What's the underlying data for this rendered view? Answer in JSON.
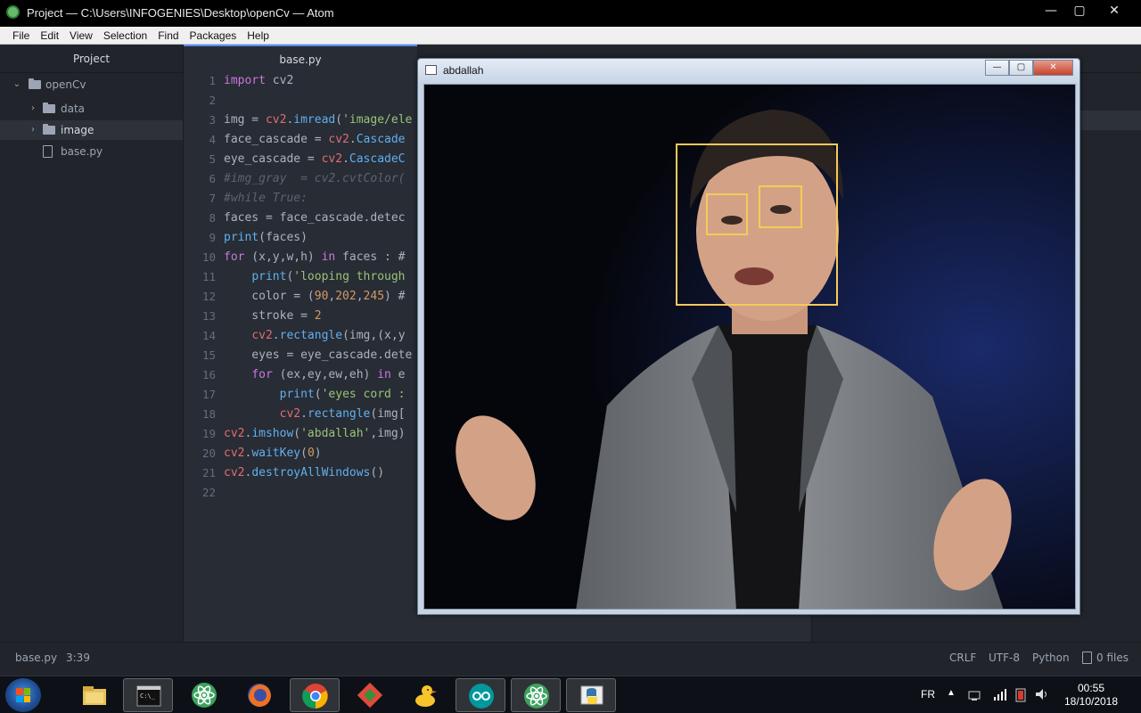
{
  "window": {
    "title": "Project — C:\\Users\\INFOGENIES\\Desktop\\openCv — Atom",
    "controls": {
      "minimize": "—",
      "maximize": "▢",
      "close": "✕"
    }
  },
  "menu": [
    "File",
    "Edit",
    "View",
    "Selection",
    "Find",
    "Packages",
    "Help"
  ],
  "tree": {
    "panel_title": "Project",
    "root": "openCv",
    "items": [
      {
        "label": "data",
        "type": "folder"
      },
      {
        "label": "image",
        "type": "folder",
        "selected": true
      },
      {
        "label": "base.py",
        "type": "file"
      }
    ]
  },
  "tabs": [
    {
      "label": "base.py",
      "active": true
    }
  ],
  "editor": {
    "line_numbers": [
      "1",
      "2",
      "3",
      "4",
      "5",
      "6",
      "7",
      "8",
      "9",
      "10",
      "11",
      "12",
      "13",
      "14",
      "15",
      "16",
      "17",
      "18",
      "19",
      "20",
      "21",
      "22"
    ],
    "lines": [
      "import cv2",
      "",
      "img = cv2.imread('image/ele",
      "face_cascade = cv2.Cascade",
      "eye_cascade = cv2.CascadeC",
      "#img_gray  = cv2.cvtColor(",
      "#while True:",
      "faces = face_cascade.detec",
      "print(faces)",
      "for (x,y,w,h) in faces : #",
      "    print('looping through",
      "    color = (90,202,245) #",
      "    stroke = 2",
      "    cv2.rectangle(img,(x,y",
      "    eyes = eye_cascade.dete",
      "    for (ex,ey,ew,eh) in e",
      "        print('eyes cord :",
      "        cv2.rectangle(img[",
      "cv2.imshow('abdallah',img)",
      "cv2.waitKey(0)",
      "cv2.destroyAllWindows()",
      ""
    ]
  },
  "status": {
    "file": "base.py",
    "cursor": "3:39",
    "line_ending": "CRLF",
    "encoding": "UTF-8",
    "grammar": "Python",
    "git": "0 files"
  },
  "cv_window": {
    "title": "abdallah",
    "controls": {
      "minimize": "—",
      "maximize": "▢",
      "close": "✕"
    }
  },
  "taskbar": {
    "apps": [
      "start",
      "file-explorer",
      "command-prompt",
      "atom",
      "firefox",
      "chrome",
      "git-kraken",
      "duck-app",
      "arduino",
      "atom-active",
      "python-active"
    ],
    "language": "FR",
    "time": "00:55",
    "date": "18/10/2018"
  },
  "colors": {
    "detection_box": "#f5ca5a",
    "accent": "#568af2",
    "editor_bg": "#282c34"
  }
}
